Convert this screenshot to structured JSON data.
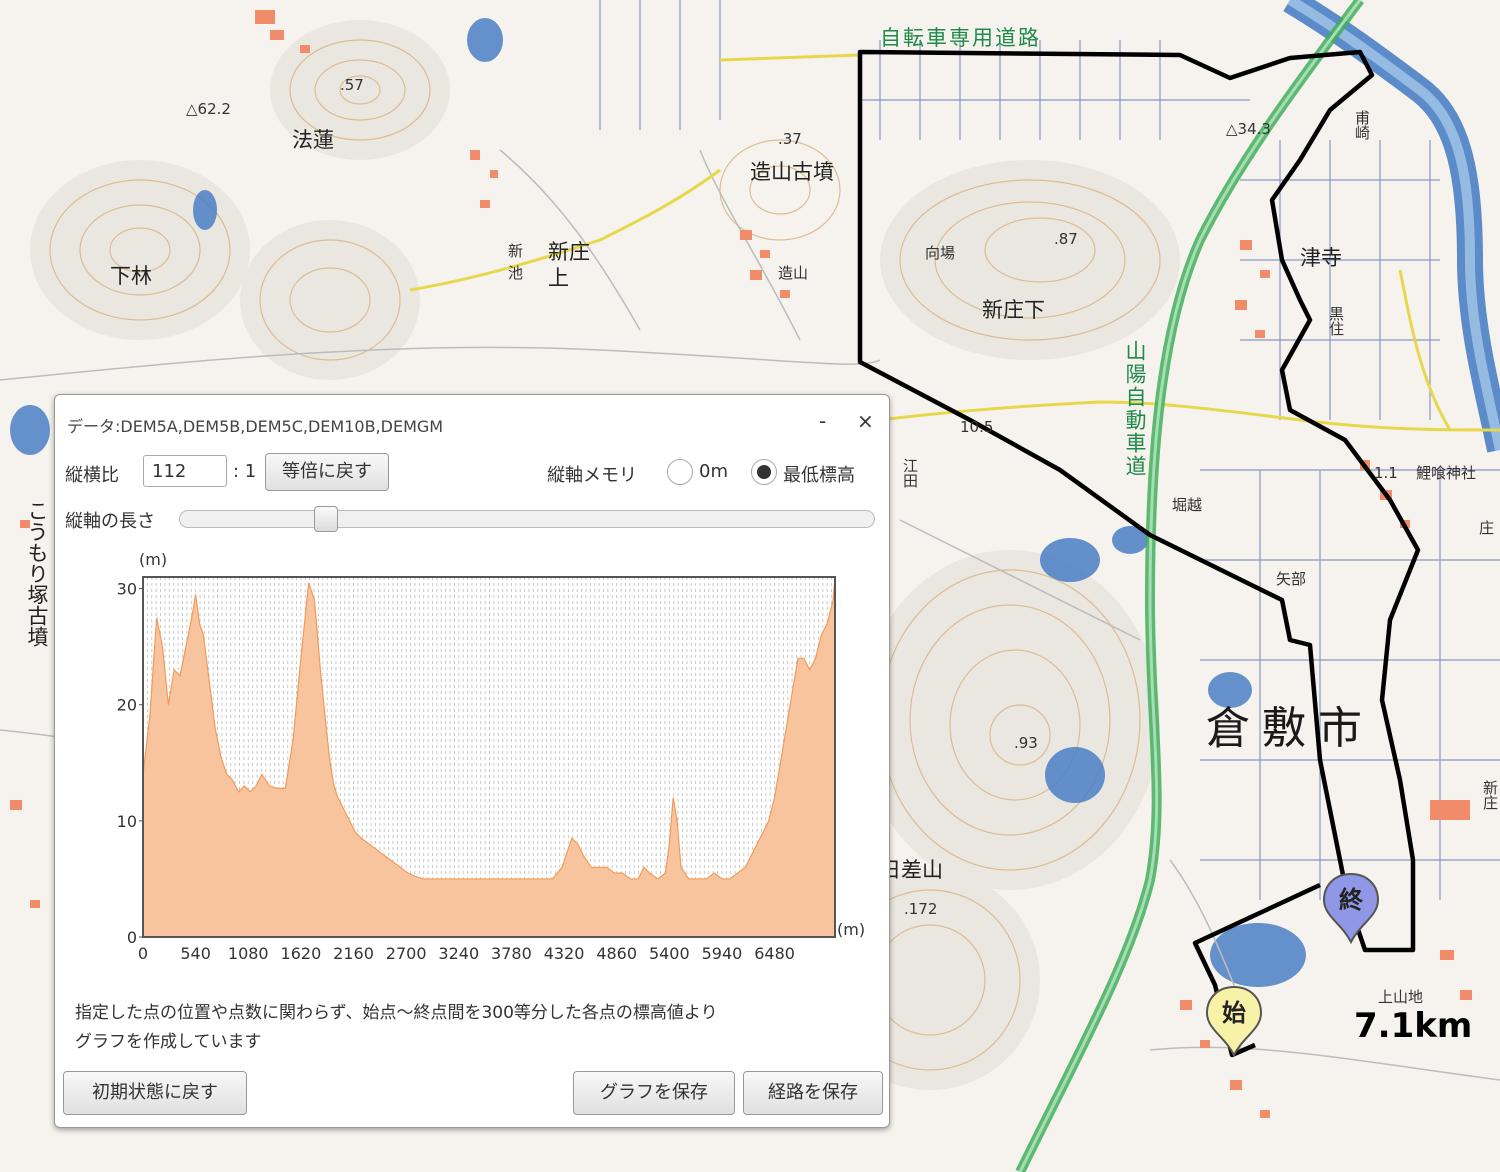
{
  "map": {
    "colors": {
      "route": "#000000",
      "road_yellow": "#e6d84a",
      "expressway": "#3fae5a",
      "river": "#4a7fc4",
      "building": "#f08c6a",
      "contour": "#d8b98a"
    },
    "labels": {
      "cycle_road": "自転車専用道路",
      "zosan_kofun": "造山古墳",
      "zosan": "造山",
      "houren": "法蓮",
      "shimobayashi": "下林",
      "shinike1": "新",
      "shinike2": "池",
      "shinsho_kami1": "新庄",
      "shinsho_kami2": "上",
      "mukoba": "向場",
      "shinsho_shimo": "新庄下",
      "expressway": "山陽自動車道",
      "hozaki": "甫崎",
      "tsudera": "津寺",
      "kurozumi": "黒住",
      "koimi_jinja": "鯉喰神社",
      "horikoshi": "堀越",
      "yabe": "矢部",
      "kurashiki": "倉敷市",
      "edaka": "江田",
      "yazashiyama": "日差山",
      "komori": "こうもり塚古墳",
      "kamiyamachi": "上山地",
      "shou": "庄",
      "niike": "新庄",
      "eg57": ".57",
      "eg62": "△62.2",
      "eg37": ".37",
      "eg87": ".87",
      "eg34": "△34.3",
      "eg93": ".93",
      "eg172": ".172",
      "eg105": "10.5",
      "eg11": "1.1"
    },
    "markers": {
      "start": "始",
      "end": "終"
    },
    "distance": "7.1km"
  },
  "panel": {
    "title": "データ:DEM5A,DEM5B,DEM5C,DEM10B,DEMGM",
    "minimize": "-",
    "close": "×",
    "aspect_label": "縦横比",
    "aspect_value": "112",
    "aspect_suffix": ": 1",
    "reset_scale_button": "等倍に戻す",
    "vaxis_memory_label": "縦軸メモリ",
    "radio_zero_label": "0m",
    "radio_min_label": "最低標高",
    "radio_selected": "最低標高",
    "vaxis_length_label": "縦軸の長さ",
    "vaxis_length_fraction": 0.2,
    "note_line1": "指定した点の位置や点数に関わらず、始点～終点間を300等分した各点の標高値より",
    "note_line2": "グラフを作成しています",
    "init_button": "初期状態に戻す",
    "save_graph_button": "グラフを保存",
    "save_route_button": "経路を保存"
  },
  "chart_data": {
    "type": "area",
    "title": "",
    "xlabel": "(m)",
    "ylabel": "(m)",
    "xlim": [
      0,
      7100
    ],
    "ylim": [
      0,
      31
    ],
    "x_ticks": [
      0,
      540,
      1080,
      1620,
      2160,
      2700,
      3240,
      3780,
      4320,
      4860,
      5400,
      5940,
      6480
    ],
    "y_ticks": [
      0,
      10,
      20,
      30
    ],
    "grid": "vertical dashed",
    "fill_color": "#f7c49d",
    "line_color": "#f29a5a",
    "x": [
      0,
      70,
      140,
      200,
      260,
      320,
      380,
      440,
      500,
      540,
      580,
      620,
      680,
      740,
      800,
      860,
      920,
      980,
      1040,
      1100,
      1160,
      1220,
      1300,
      1380,
      1460,
      1540,
      1620,
      1700,
      1760,
      1820,
      1880,
      1920,
      1960,
      2000,
      2060,
      2120,
      2180,
      2240,
      2320,
      2400,
      2480,
      2560,
      2640,
      2720,
      2800,
      2880,
      2960,
      3060,
      3160,
      3240,
      3400,
      3560,
      3720,
      3880,
      4040,
      4200,
      4300,
      4400,
      4460,
      4520,
      4560,
      4600,
      4680,
      4760,
      4840,
      4920,
      5000,
      5080,
      5140,
      5200,
      5280,
      5360,
      5400,
      5440,
      5480,
      5520,
      5560,
      5600,
      5660,
      5720,
      5780,
      5860,
      5940,
      6020,
      6100,
      6180,
      6240,
      6300,
      6360,
      6420,
      6480,
      6540,
      6600,
      6660,
      6720,
      6780,
      6840,
      6900,
      6960,
      7020,
      7080,
      7100
    ],
    "values": [
      14,
      19,
      27.5,
      25,
      20,
      23,
      22.5,
      25,
      27.5,
      29.5,
      27,
      26,
      22,
      18,
      15.5,
      14,
      13.5,
      12.5,
      13,
      12.5,
      13,
      14,
      13,
      12.8,
      12.8,
      17,
      24,
      30.5,
      29,
      23,
      18,
      15,
      13,
      12,
      11,
      10,
      9,
      8.5,
      8,
      7.5,
      7,
      6.5,
      6,
      5.5,
      5.2,
      5,
      5,
      5,
      5,
      5,
      5,
      5,
      5,
      5,
      5,
      5,
      6,
      8.5,
      8,
      7,
      6.5,
      6,
      6,
      6,
      5.5,
      5.5,
      5,
      5,
      6,
      5.5,
      5,
      5.5,
      8,
      12,
      10,
      6,
      5.5,
      5,
      5,
      5,
      5,
      5.5,
      5,
      5,
      5.5,
      6,
      7,
      8,
      9,
      10,
      12,
      15,
      18,
      21,
      24,
      24,
      23,
      24,
      26,
      27,
      29,
      31
    ]
  }
}
